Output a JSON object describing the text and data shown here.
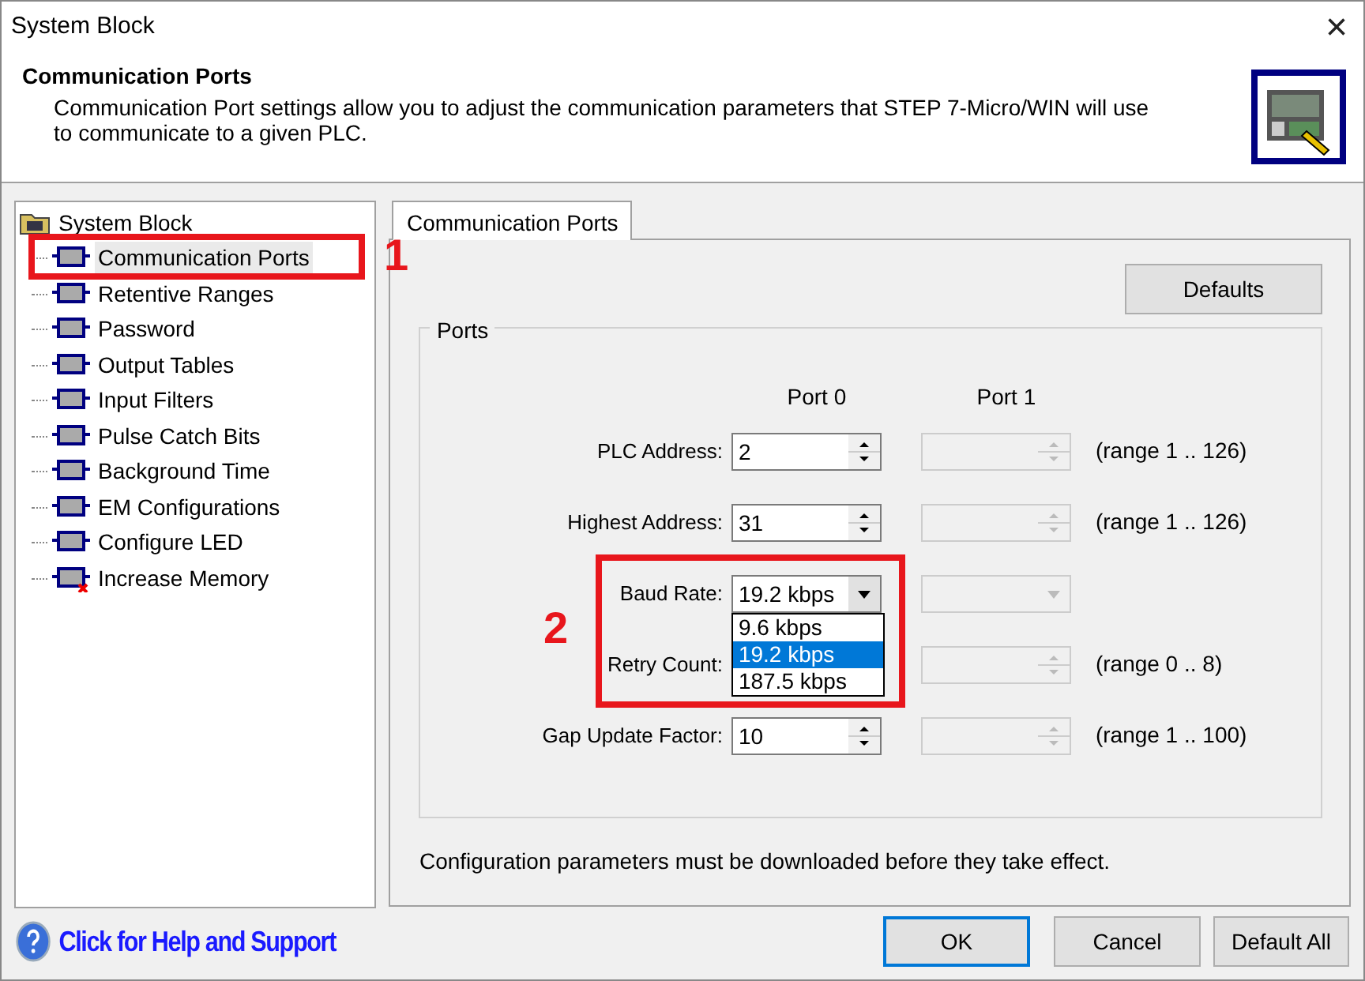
{
  "window": {
    "title": "System Block",
    "close": "×"
  },
  "header": {
    "title": "Communication Ports",
    "description": "Communication Port settings allow you to adjust the communication parameters that STEP 7-Micro/WIN will use to communicate to a given PLC."
  },
  "tree": {
    "label": "System Block",
    "children": [
      {
        "label": "Communication Ports",
        "selected": true,
        "kind": "module"
      },
      {
        "label": "Retentive Ranges",
        "selected": false,
        "kind": "module"
      },
      {
        "label": "Password",
        "selected": false,
        "kind": "module"
      },
      {
        "label": "Output Tables",
        "selected": false,
        "kind": "module"
      },
      {
        "label": "Input Filters",
        "selected": false,
        "kind": "module"
      },
      {
        "label": "Pulse Catch Bits",
        "selected": false,
        "kind": "module"
      },
      {
        "label": "Background Time",
        "selected": false,
        "kind": "module"
      },
      {
        "label": "EM Configurations",
        "selected": false,
        "kind": "module"
      },
      {
        "label": "Configure LED",
        "selected": false,
        "kind": "module"
      },
      {
        "label": "Increase Memory",
        "selected": false,
        "kind": "module-error"
      }
    ]
  },
  "tabs": [
    {
      "label": "Communication Ports",
      "selected": true
    }
  ],
  "defaults_button": "Defaults",
  "ports": {
    "title": "Ports",
    "columns": [
      "Port 0",
      "Port 1"
    ],
    "rows": [
      {
        "kind": "spin",
        "label": "PLC Address:",
        "port0": {
          "value": "2",
          "disabled": false
        },
        "port1": {
          "disabled": true
        },
        "range": "(range 1 .. 126)"
      },
      {
        "kind": "spin",
        "label": "Highest Address:",
        "port0": {
          "value": "31",
          "disabled": false
        },
        "port1": {
          "disabled": true
        },
        "range": "(range 1 .. 126)"
      },
      {
        "kind": "combo",
        "label": "Baud Rate:",
        "port0": {
          "value": "19.2 kbps",
          "disabled": false,
          "expanded": true,
          "options": [
            {
              "label": "9.6 kbps",
              "selected": false
            },
            {
              "label": "19.2 kbps",
              "selected": true
            },
            {
              "label": "187.5 kbps",
              "selected": false
            }
          ]
        },
        "port1": {
          "disabled": true
        }
      },
      {
        "kind": "spin",
        "label": "Retry Count:",
        "port1": {
          "disabled": true
        },
        "range": "(range 0 .. 8)"
      },
      {
        "kind": "spin",
        "label": "Gap Update Factor:",
        "port0": {
          "value": "10",
          "disabled": false
        },
        "port1": {
          "disabled": true
        },
        "range": "(range 1 .. 100)"
      }
    ]
  },
  "note": "Configuration parameters must be downloaded before they take effect.",
  "help_link": "Click for Help and Support",
  "buttons": [
    "OK",
    "Cancel",
    "Default All"
  ],
  "annotations": [
    {
      "label": "1"
    },
    {
      "label": "2"
    }
  ]
}
